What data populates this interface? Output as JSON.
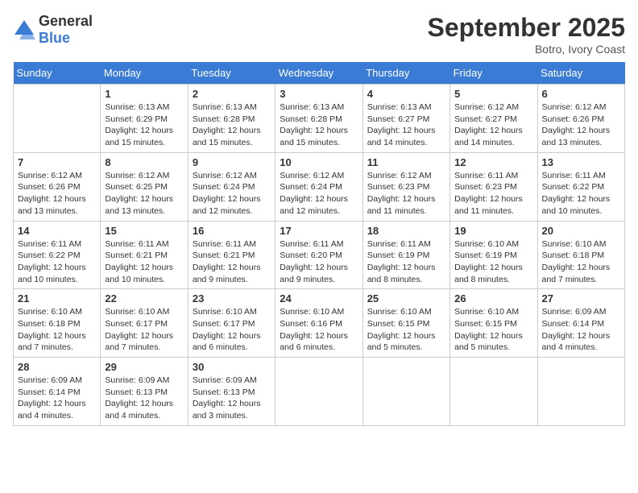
{
  "logo": {
    "general": "General",
    "blue": "Blue"
  },
  "title": {
    "month": "September 2025",
    "location": "Botro, Ivory Coast"
  },
  "weekdays": [
    "Sunday",
    "Monday",
    "Tuesday",
    "Wednesday",
    "Thursday",
    "Friday",
    "Saturday"
  ],
  "weeks": [
    [
      {
        "day": "",
        "info": ""
      },
      {
        "day": "1",
        "info": "Sunrise: 6:13 AM\nSunset: 6:29 PM\nDaylight: 12 hours\nand 15 minutes."
      },
      {
        "day": "2",
        "info": "Sunrise: 6:13 AM\nSunset: 6:28 PM\nDaylight: 12 hours\nand 15 minutes."
      },
      {
        "day": "3",
        "info": "Sunrise: 6:13 AM\nSunset: 6:28 PM\nDaylight: 12 hours\nand 15 minutes."
      },
      {
        "day": "4",
        "info": "Sunrise: 6:13 AM\nSunset: 6:27 PM\nDaylight: 12 hours\nand 14 minutes."
      },
      {
        "day": "5",
        "info": "Sunrise: 6:12 AM\nSunset: 6:27 PM\nDaylight: 12 hours\nand 14 minutes."
      },
      {
        "day": "6",
        "info": "Sunrise: 6:12 AM\nSunset: 6:26 PM\nDaylight: 12 hours\nand 13 minutes."
      }
    ],
    [
      {
        "day": "7",
        "info": "Sunrise: 6:12 AM\nSunset: 6:26 PM\nDaylight: 12 hours\nand 13 minutes."
      },
      {
        "day": "8",
        "info": "Sunrise: 6:12 AM\nSunset: 6:25 PM\nDaylight: 12 hours\nand 13 minutes."
      },
      {
        "day": "9",
        "info": "Sunrise: 6:12 AM\nSunset: 6:24 PM\nDaylight: 12 hours\nand 12 minutes."
      },
      {
        "day": "10",
        "info": "Sunrise: 6:12 AM\nSunset: 6:24 PM\nDaylight: 12 hours\nand 12 minutes."
      },
      {
        "day": "11",
        "info": "Sunrise: 6:12 AM\nSunset: 6:23 PM\nDaylight: 12 hours\nand 11 minutes."
      },
      {
        "day": "12",
        "info": "Sunrise: 6:11 AM\nSunset: 6:23 PM\nDaylight: 12 hours\nand 11 minutes."
      },
      {
        "day": "13",
        "info": "Sunrise: 6:11 AM\nSunset: 6:22 PM\nDaylight: 12 hours\nand 10 minutes."
      }
    ],
    [
      {
        "day": "14",
        "info": "Sunrise: 6:11 AM\nSunset: 6:22 PM\nDaylight: 12 hours\nand 10 minutes."
      },
      {
        "day": "15",
        "info": "Sunrise: 6:11 AM\nSunset: 6:21 PM\nDaylight: 12 hours\nand 10 minutes."
      },
      {
        "day": "16",
        "info": "Sunrise: 6:11 AM\nSunset: 6:21 PM\nDaylight: 12 hours\nand 9 minutes."
      },
      {
        "day": "17",
        "info": "Sunrise: 6:11 AM\nSunset: 6:20 PM\nDaylight: 12 hours\nand 9 minutes."
      },
      {
        "day": "18",
        "info": "Sunrise: 6:11 AM\nSunset: 6:19 PM\nDaylight: 12 hours\nand 8 minutes."
      },
      {
        "day": "19",
        "info": "Sunrise: 6:10 AM\nSunset: 6:19 PM\nDaylight: 12 hours\nand 8 minutes."
      },
      {
        "day": "20",
        "info": "Sunrise: 6:10 AM\nSunset: 6:18 PM\nDaylight: 12 hours\nand 7 minutes."
      }
    ],
    [
      {
        "day": "21",
        "info": "Sunrise: 6:10 AM\nSunset: 6:18 PM\nDaylight: 12 hours\nand 7 minutes."
      },
      {
        "day": "22",
        "info": "Sunrise: 6:10 AM\nSunset: 6:17 PM\nDaylight: 12 hours\nand 7 minutes."
      },
      {
        "day": "23",
        "info": "Sunrise: 6:10 AM\nSunset: 6:17 PM\nDaylight: 12 hours\nand 6 minutes."
      },
      {
        "day": "24",
        "info": "Sunrise: 6:10 AM\nSunset: 6:16 PM\nDaylight: 12 hours\nand 6 minutes."
      },
      {
        "day": "25",
        "info": "Sunrise: 6:10 AM\nSunset: 6:15 PM\nDaylight: 12 hours\nand 5 minutes."
      },
      {
        "day": "26",
        "info": "Sunrise: 6:10 AM\nSunset: 6:15 PM\nDaylight: 12 hours\nand 5 minutes."
      },
      {
        "day": "27",
        "info": "Sunrise: 6:09 AM\nSunset: 6:14 PM\nDaylight: 12 hours\nand 4 minutes."
      }
    ],
    [
      {
        "day": "28",
        "info": "Sunrise: 6:09 AM\nSunset: 6:14 PM\nDaylight: 12 hours\nand 4 minutes."
      },
      {
        "day": "29",
        "info": "Sunrise: 6:09 AM\nSunset: 6:13 PM\nDaylight: 12 hours\nand 4 minutes."
      },
      {
        "day": "30",
        "info": "Sunrise: 6:09 AM\nSunset: 6:13 PM\nDaylight: 12 hours\nand 3 minutes."
      },
      {
        "day": "",
        "info": ""
      },
      {
        "day": "",
        "info": ""
      },
      {
        "day": "",
        "info": ""
      },
      {
        "day": "",
        "info": ""
      }
    ]
  ]
}
